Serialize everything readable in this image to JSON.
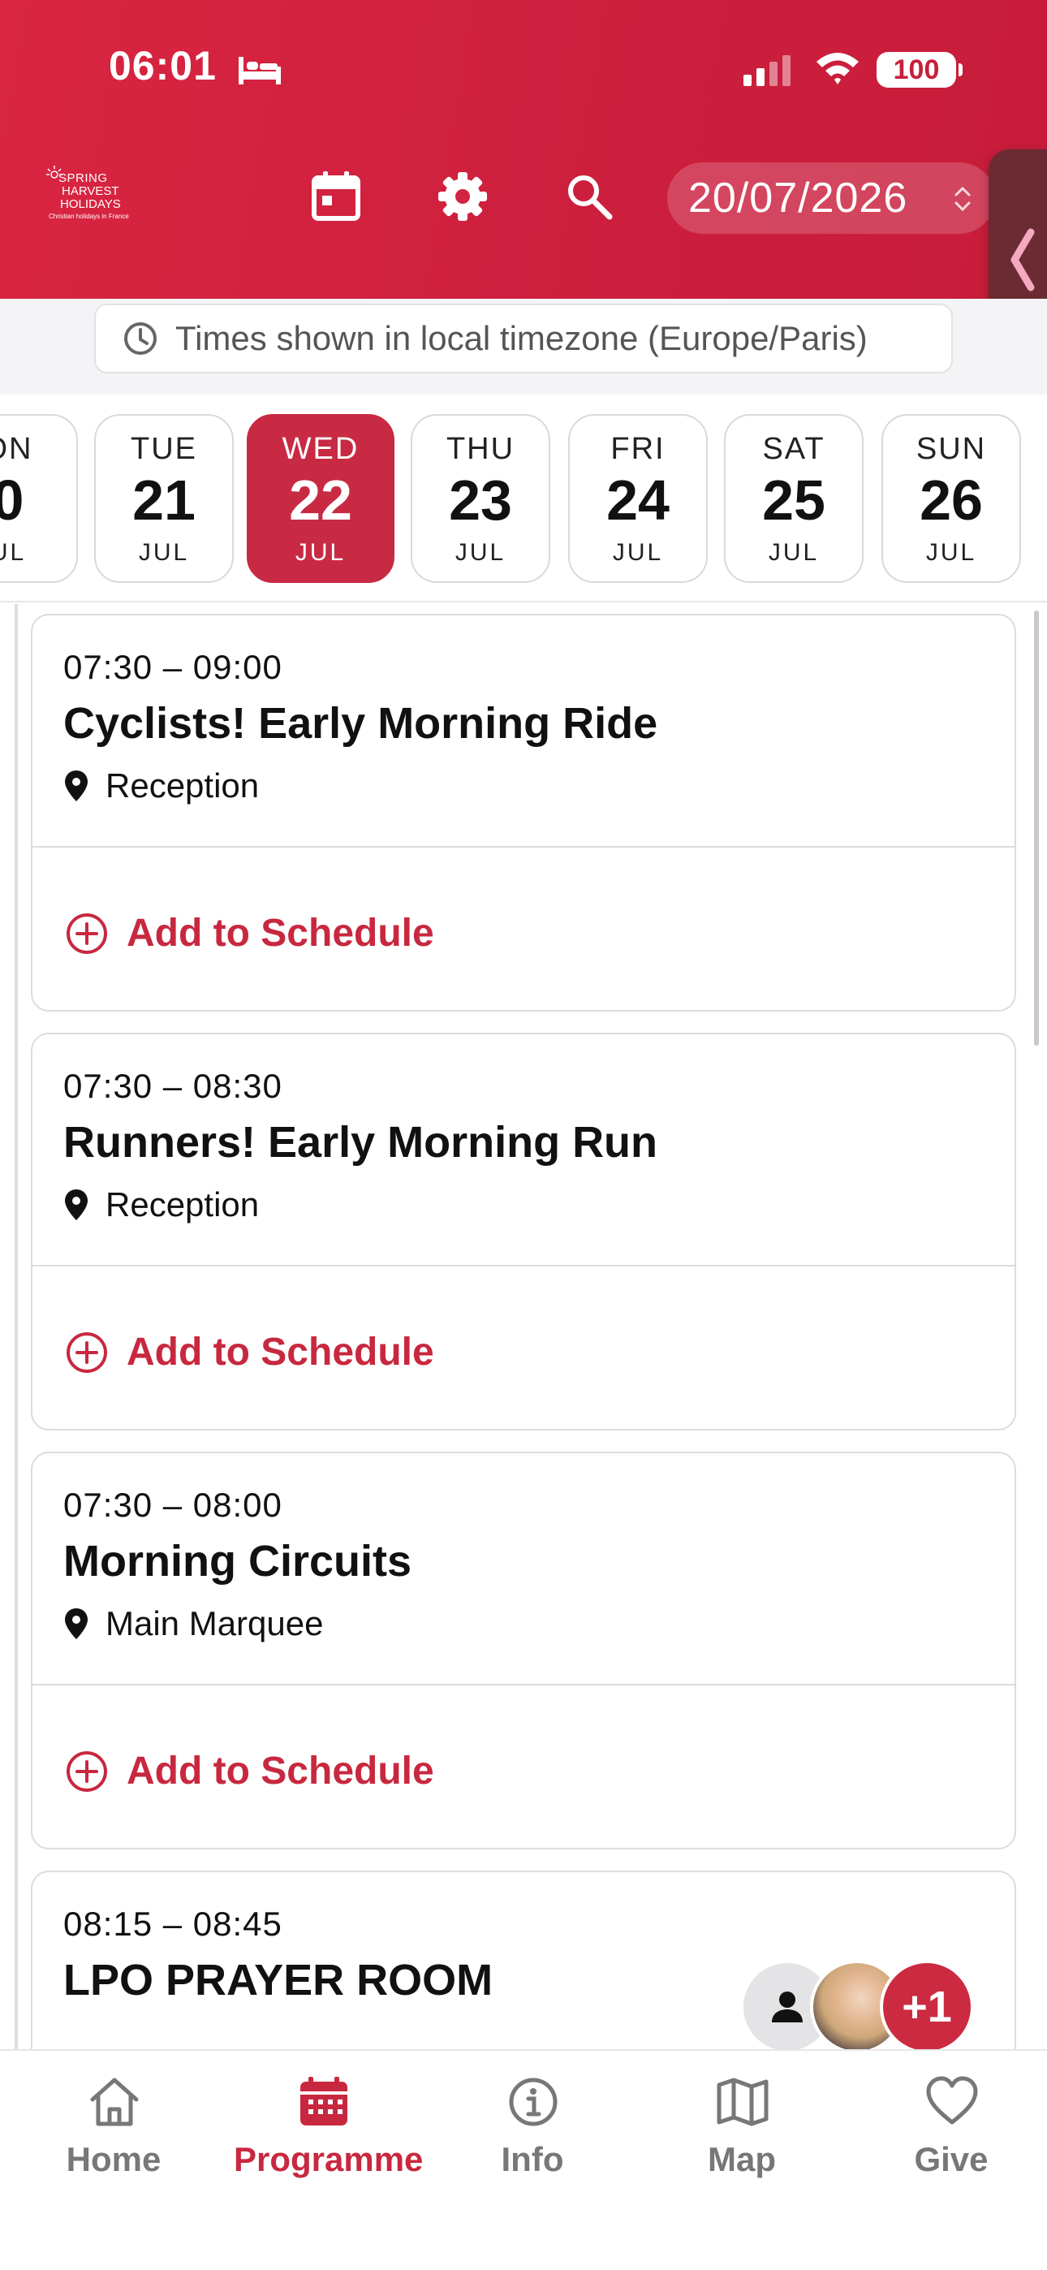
{
  "status_bar": {
    "time": "06:01",
    "battery": "100"
  },
  "header": {
    "logo_lines": [
      "SPRING",
      "HARVEST",
      "HOLIDAYS",
      "Christian holidays in France"
    ],
    "date_value": "20/07/2026"
  },
  "timezone_notice": "Times shown in local timezone (Europe/Paris)",
  "days": [
    {
      "dow": "ON",
      "num": "0",
      "mon": "UL"
    },
    {
      "dow": "TUE",
      "num": "21",
      "mon": "JUL"
    },
    {
      "dow": "WED",
      "num": "22",
      "mon": "JUL",
      "selected": true
    },
    {
      "dow": "THU",
      "num": "23",
      "mon": "JUL"
    },
    {
      "dow": "FRI",
      "num": "24",
      "mon": "JUL"
    },
    {
      "dow": "SAT",
      "num": "25",
      "mon": "JUL"
    },
    {
      "dow": "SUN",
      "num": "26",
      "mon": "JUL"
    }
  ],
  "events": [
    {
      "time": "07:30 – 09:00",
      "title": "Cyclists! Early Morning Ride",
      "location": "Reception",
      "action": "Add to Schedule"
    },
    {
      "time": "07:30 – 08:30",
      "title": "Runners! Early Morning Run",
      "location": "Reception",
      "action": "Add to Schedule"
    },
    {
      "time": "07:30 – 08:00",
      "title": "Morning Circuits",
      "location": "Main Marquee",
      "action": "Add to Schedule"
    },
    {
      "time": "08:15 – 08:45",
      "title": "LPO PRAYER ROOM"
    }
  ],
  "attendees": {
    "extra_count": "+1"
  },
  "nav": [
    {
      "label": "Home",
      "icon": "home-icon"
    },
    {
      "label": "Programme",
      "icon": "calendar-icon",
      "active": true
    },
    {
      "label": "Info",
      "icon": "info-icon"
    },
    {
      "label": "Map",
      "icon": "map-icon"
    },
    {
      "label": "Give",
      "icon": "heart-icon"
    }
  ],
  "colors": {
    "brand_red": "#c8283f",
    "header_red": "#d92541"
  }
}
